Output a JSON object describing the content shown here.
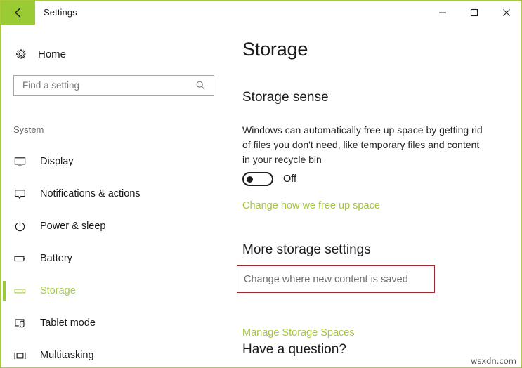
{
  "window": {
    "app_title": "Settings",
    "accent_color": "#9bcb33",
    "border_color": "#aacb3c",
    "back_icon": "back-arrow-icon",
    "controls": [
      {
        "name": "minimize",
        "icon": "minimize-icon"
      },
      {
        "name": "maximize",
        "icon": "maximize-icon"
      },
      {
        "name": "close",
        "icon": "close-icon"
      }
    ]
  },
  "sidebar": {
    "home": {
      "label": "Home",
      "icon": "gear-icon"
    },
    "search": {
      "placeholder": "Find a setting",
      "value": "",
      "icon": "search-icon"
    },
    "group_label": "System",
    "items": [
      {
        "label": "Display",
        "icon": "monitor-icon",
        "selected": false
      },
      {
        "label": "Notifications & actions",
        "icon": "speech-bubble-icon",
        "selected": false
      },
      {
        "label": "Power & sleep",
        "icon": "power-icon",
        "selected": false
      },
      {
        "label": "Battery",
        "icon": "battery-icon",
        "selected": false
      },
      {
        "label": "Storage",
        "icon": "drive-icon",
        "selected": true
      },
      {
        "label": "Tablet mode",
        "icon": "tablet-touch-icon",
        "selected": false
      },
      {
        "label": "Multitasking",
        "icon": "multitasking-icon",
        "selected": false
      }
    ],
    "selected_color": "#a4cc4c"
  },
  "main": {
    "page_title": "Storage",
    "storage_sense": {
      "heading": "Storage sense",
      "description": "Windows can automatically free up space by getting rid of files you don't need, like temporary files and content in your recycle bin",
      "toggle_state": "Off",
      "toggle_on": false,
      "link": "Change how we free up space"
    },
    "more_storage_settings": {
      "heading": "More storage settings",
      "change_content_link": "Change where new content is saved",
      "manage_spaces_link": "Manage Storage Spaces",
      "annotation_color": "#9e2a2f"
    },
    "question": {
      "heading": "Have a question?"
    },
    "link_color": "#a4c63d"
  },
  "watermark": {
    "text": "wsxdn.com"
  }
}
